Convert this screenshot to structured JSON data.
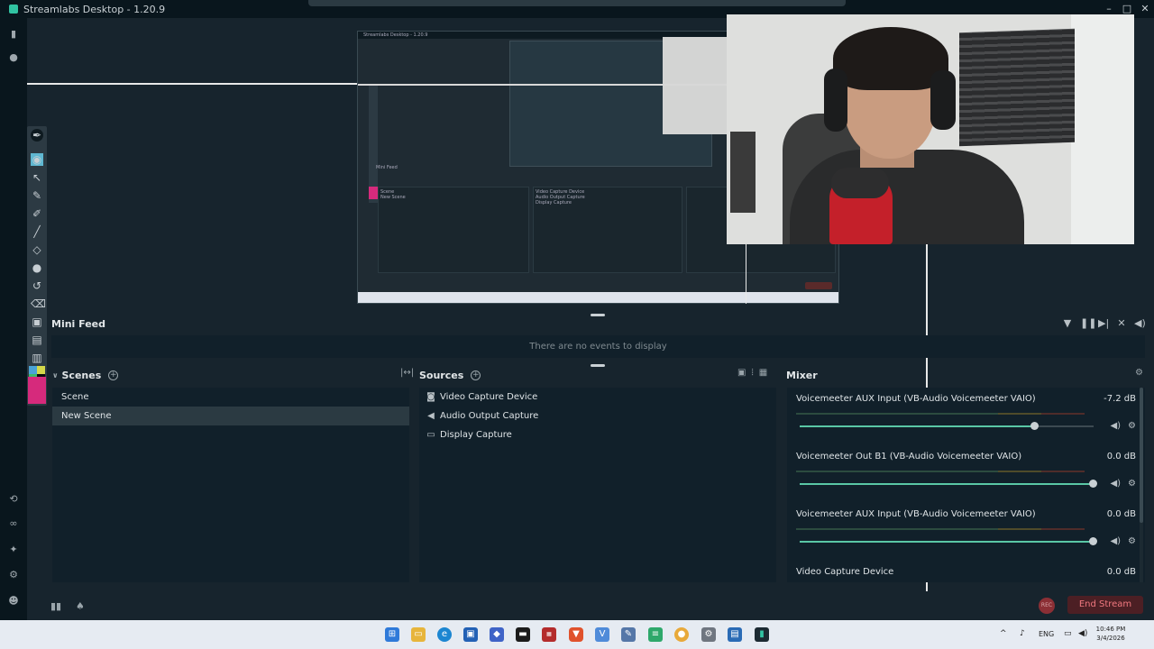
{
  "window": {
    "title": "Streamlabs Desktop - 1.20.9",
    "controls": [
      "–",
      "□",
      "✕"
    ]
  },
  "leftnav": {
    "top_icons": [
      "studio-icon",
      "play-icon"
    ],
    "bottom_icons": [
      "cloud-icon",
      "link-icon",
      "sparkle-icon",
      "settings-icon",
      "user-icon"
    ]
  },
  "drawing_toolbar": {
    "tools": [
      "pen-cursor-icon",
      "eye-icon",
      "arrow-icon",
      "pen-icon",
      "brush-icon",
      "line-icon",
      "eraser-icon",
      "dot-icon",
      "undo-icon",
      "trash-icon",
      "screen-icon",
      "camera-icon",
      "clipboard-icon"
    ],
    "accent": "#d62a7c"
  },
  "preview": {
    "nested_title": "Streamlabs Desktop - 1.20.9",
    "nested_feed": "Mini Feed",
    "nested_scenes": [
      "Scene",
      "New Scene"
    ],
    "nested_sources": [
      "Video Capture Device",
      "Audio Output Capture",
      "Display Capture"
    ]
  },
  "minifeed": {
    "title": "Mini Feed",
    "empty_text": "There are no events to display",
    "controls": [
      "filter-icon",
      "pause-icon",
      "skip-icon",
      "mute-feed-icon",
      "volume-icon"
    ]
  },
  "scenes": {
    "title": "Scenes",
    "items": [
      {
        "label": "Scene",
        "selected": false
      },
      {
        "label": "New Scene",
        "selected": true
      }
    ]
  },
  "sources": {
    "title": "Sources",
    "items": [
      {
        "label": "Video Capture Device",
        "icon": "camera-icon"
      },
      {
        "label": "Audio Output Capture",
        "icon": "speaker-icon"
      },
      {
        "label": "Display Capture",
        "icon": "monitor-icon"
      }
    ]
  },
  "mixer": {
    "title": "Mixer",
    "channels": [
      {
        "name": "Voicemeeter AUX Input (VB-Audio Voicemeeter VAIO)",
        "db": "-7.2 dB",
        "level": 0.8
      },
      {
        "name": "Voicemeeter Out B1 (VB-Audio Voicemeeter VAIO)",
        "db": "0.0 dB",
        "level": 1.0
      },
      {
        "name": "Voicemeeter AUX Input (VB-Audio Voicemeeter VAIO)",
        "db": "0.0 dB",
        "level": 1.0
      },
      {
        "name": "Video Capture Device",
        "db": "0.0 dB",
        "level": 1.0
      }
    ]
  },
  "footer": {
    "rec_label": "REC",
    "end_stream_label": "End Stream"
  },
  "taskbar": {
    "tray_lang": "ENG",
    "clock_time": "10:46 PM",
    "clock_date": "3/4/2026"
  },
  "colors": {
    "accent_green": "#5ac7a5",
    "end_stream_red": "#f0787f",
    "panel_bg": "#11202a"
  }
}
